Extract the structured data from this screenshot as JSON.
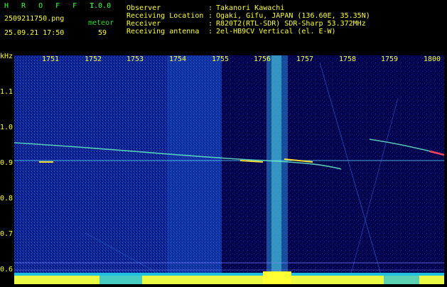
{
  "app": {
    "title": "H R O F F T",
    "version": "1.0.0"
  },
  "file": {
    "name": "2509211750.png",
    "datetime": "25.09.21 17:50"
  },
  "meteor": {
    "label": "meteor",
    "count": "59"
  },
  "info": [
    {
      "label": "Observer",
      "sep": ":",
      "value": "Takanori Kawachi"
    },
    {
      "label": "Receiving Location",
      "sep": ":",
      "value": "Ogaki, Gifu, JAPAN (136.60E, 35.35N)"
    },
    {
      "label": "Receiver",
      "sep": ":",
      "value": "R820T2(RTL-SDR) SDR-Sharp 53.372MHz"
    },
    {
      "label": "Receiving antenna",
      "sep": ":",
      "value": "2el-HB9CV Vertical (el. E-W)"
    }
  ],
  "axis": {
    "y_unit": "kHz",
    "y_ticks": [
      "1.1",
      "1.0",
      "0.9",
      "0.8",
      "0.7",
      "0.6"
    ],
    "x_ticks": [
      "1751",
      "1752",
      "1753",
      "1754",
      "1755",
      "1756",
      "1757",
      "1758",
      "1759",
      "1800"
    ]
  },
  "colors": {
    "background": "#000000",
    "waterfall": "#00004a",
    "text_yellow": "#ffff33",
    "text_green": "#44ff44"
  }
}
